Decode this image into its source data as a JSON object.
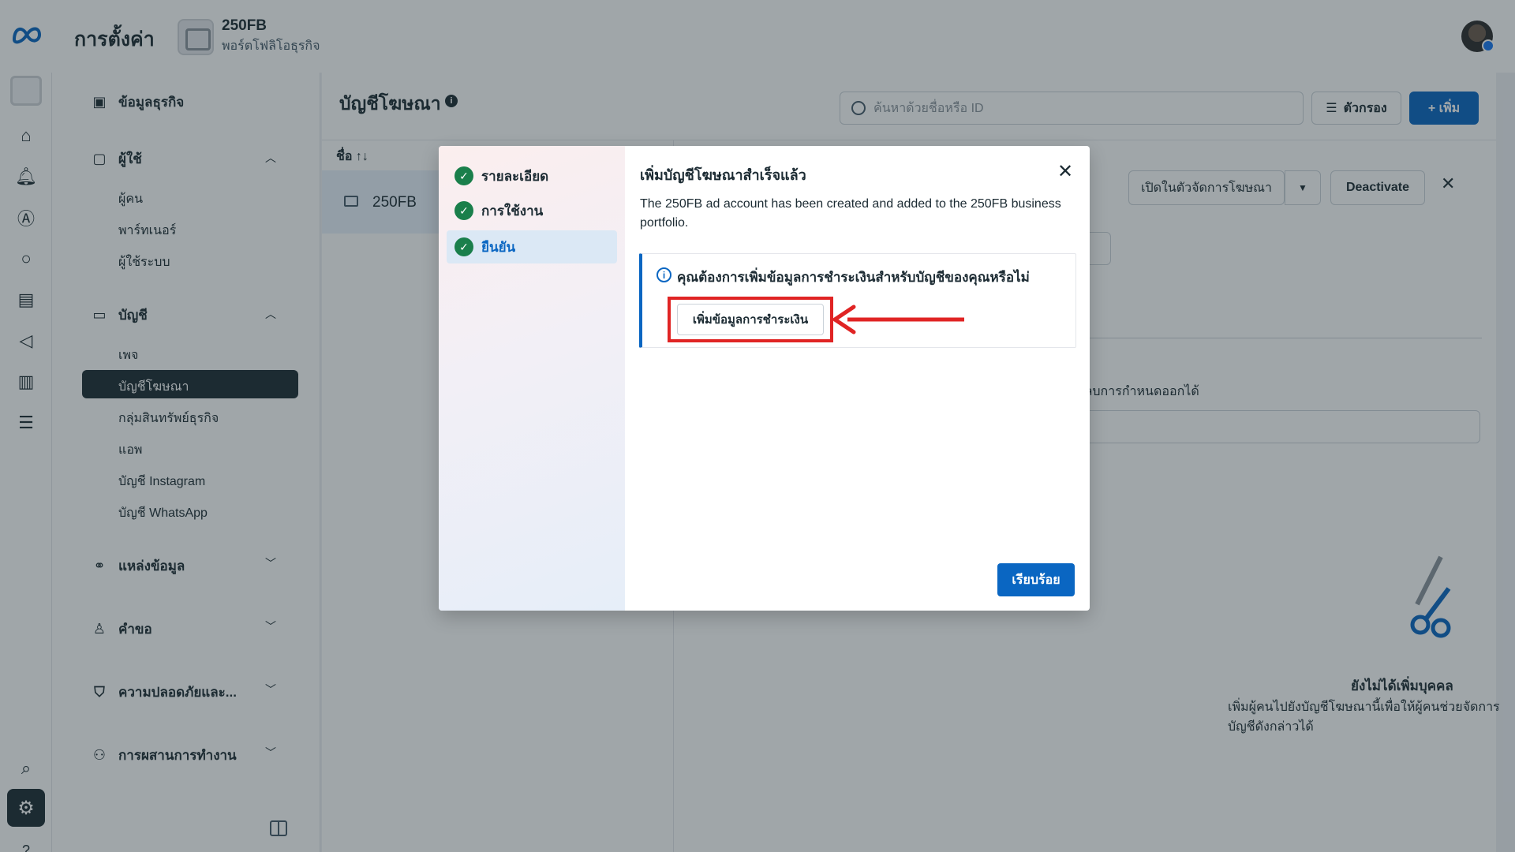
{
  "app": {
    "title": "การตั้งค่า",
    "portfolio_name": "250FB",
    "portfolio_sub": "พอร์ตโฟลิโอธุรกิจ"
  },
  "sidebar": {
    "business_info": "ข้อมูลธุรกิจ",
    "users": "ผู้ใช้",
    "users_items": [
      "ผู้คน",
      "พาร์ทเนอร์",
      "ผู้ใช้ระบบ"
    ],
    "accounts": "บัญชี",
    "accounts_items": [
      "เพจ",
      "บัญชีโฆษณา",
      "กลุ่มสินทรัพย์ธุรกิจ",
      "แอพ",
      "บัญชี Instagram",
      "บัญชี WhatsApp"
    ],
    "data_sources": "แหล่งข้อมูล",
    "requests": "คำขอ",
    "security": "ความปลอดภัยและ...",
    "integrations": "การผสานการทำงาน"
  },
  "main": {
    "title": "บัญชีโฆษณา",
    "search_placeholder": "ค้นหาด้วยชื่อหรือ ID",
    "filter_label": "ตัวกรอง",
    "add_label": "+ เพิ่ม",
    "list_header": "ชื่อ ↑↓",
    "list_row": "250FB",
    "open_in_manager": "เปิดในตัวจัดการโฆษณา",
    "deactivate": "Deactivate",
    "remove_text": "ะลบการกำหนดออกได้",
    "empty_title": "ยังไม่ได้เพิ่มบุคคล",
    "empty_desc": "เพิ่มผู้คนไปยังบัญชีโฆษณานี้เพื่อให้ผู้คนช่วยจัดการบัญชีดังกล่าวได้"
  },
  "modal": {
    "steps": [
      {
        "label": "รายละเอียด",
        "state": "done"
      },
      {
        "label": "การใช้งาน",
        "state": "done"
      },
      {
        "label": "ยืนยัน",
        "state": "active"
      }
    ],
    "title": "เพิ่มบัญชีโฆษณาสำเร็จแล้ว",
    "description": "The 250FB ad account has been created and added to the 250FB business portfolio.",
    "notice": "คุณต้องการเพิ่มข้อมูลการชำระเงินสำหรับบัญชีของคุณหรือไม่",
    "payment_button": "เพิ่มข้อมูลการชำระเงิน",
    "done_button": "เรียบร้อย"
  },
  "colors": {
    "primary": "#0a66c2",
    "dark": "#1c2b33",
    "success": "#1a7f4b",
    "highlight": "#e02424"
  }
}
